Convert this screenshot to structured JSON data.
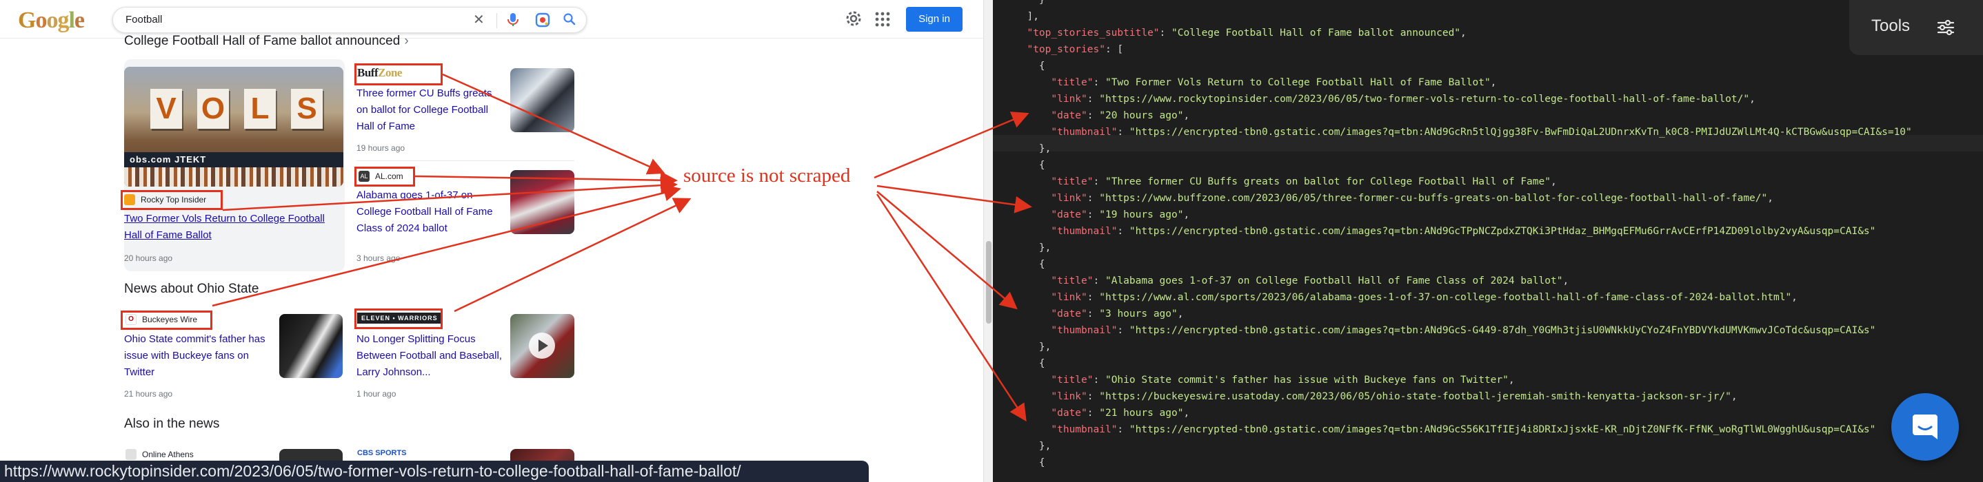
{
  "search": {
    "query": "Football",
    "signin_label": "Sign in"
  },
  "top_stories_left": {
    "section_title": "College Football Hall of Fame ballot announced",
    "featured": {
      "source": "Rocky Top Insider",
      "headline": "Two Former Vols Return to College Football Hall of Fame Ballot",
      "age": "20 hours ago",
      "hero_text": "VOLS"
    },
    "story_buffzone": {
      "source_logo_main": "Buff",
      "source_logo_accent": "Zone",
      "headline": "Three former CU Buffs greats on ballot for College Football Hall of Fame",
      "age": "19 hours ago"
    },
    "story_al": {
      "source": "AL.com",
      "headline": "Alabama goes 1-of-37 on College Football Hall of Fame Class of 2024 ballot",
      "age": "3 hours ago"
    }
  },
  "ohio_state": {
    "section_title": "News about Ohio State",
    "story_buckeyes": {
      "source": "Buckeyes Wire",
      "headline": "Ohio State commit's father has issue with Buckeye fans on Twitter",
      "age": "21 hours ago"
    },
    "story_elevenwarriors": {
      "source": "ELEVEN • WARRIORS",
      "headline": "No Longer Splitting Focus Between Football and Baseball, Larry Johnson...",
      "age": "1 hour ago"
    }
  },
  "also_in_news": {
    "section_title": "Also in the news",
    "source_1": "Online Athens",
    "source_2": "CBS SPORTS"
  },
  "hero_strip_text": "obs.com   JTEKT",
  "status_url": "https://www.rockytopinsider.com/2023/06/05/two-former-vols-return-to-college-football-hall-of-fame-ballot/",
  "annotation": "source is not scraped",
  "tools_label": "Tools",
  "code_lines": [
    [
      "p",
      "    }"
    ],
    [
      "p",
      "  ],"
    ],
    [
      "kv",
      "  ",
      "\"top_stories_subtitle\"",
      ": ",
      "\"College Football Hall of Fame ballot announced\"",
      ","
    ],
    [
      "kv",
      "  ",
      "\"top_stories\"",
      ": [",
      "",
      ""
    ],
    [
      "p",
      "    {"
    ],
    [
      "kv",
      "      ",
      "\"title\"",
      ": ",
      "\"Two Former Vols Return to College Football Hall of Fame Ballot\"",
      ","
    ],
    [
      "kv",
      "      ",
      "\"link\"",
      ": ",
      "\"https://www.rockytopinsider.com/2023/06/05/two-former-vols-return-to-college-football-hall-of-fame-ballot/\"",
      ","
    ],
    [
      "kv",
      "      ",
      "\"date\"",
      ": ",
      "\"20 hours ago\"",
      ","
    ],
    [
      "kv",
      "      ",
      "\"thumbnail\"",
      ": ",
      "\"https://encrypted-tbn0.gstatic.com/images?q=tbn:ANd9GcRn5tlQjgg38Fv-BwFmDiQaL2UDnrxKvTn_k0C8-PMIJdUZWlLMt4Q-kCTBGw&usqp=CAI&s=10\"",
      ""
    ],
    [
      "p",
      "    },"
    ],
    [
      "p",
      "    {"
    ],
    [
      "kv",
      "      ",
      "\"title\"",
      ": ",
      "\"Three former CU Buffs greats on ballot for College Football Hall of Fame\"",
      ","
    ],
    [
      "kv",
      "      ",
      "\"link\"",
      ": ",
      "\"https://www.buffzone.com/2023/06/05/three-former-cu-buffs-greats-on-ballot-for-college-football-hall-of-fame/\"",
      ","
    ],
    [
      "kv",
      "      ",
      "\"date\"",
      ": ",
      "\"19 hours ago\"",
      ","
    ],
    [
      "kv",
      "      ",
      "\"thumbnail\"",
      ": ",
      "\"https://encrypted-tbn0.gstatic.com/images?q=tbn:ANd9GcTPpNCZpdxZTQKi3PtHdaz_BHMgqEFMu6GrrAvCErfP14ZD09lolby2vyA&usqp=CAI&s\"",
      ""
    ],
    [
      "p",
      "    },"
    ],
    [
      "p",
      "    {"
    ],
    [
      "kv",
      "      ",
      "\"title\"",
      ": ",
      "\"Alabama goes 1-of-37 on College Football Hall of Fame Class of 2024 ballot\"",
      ","
    ],
    [
      "kv",
      "      ",
      "\"link\"",
      ": ",
      "\"https://www.al.com/sports/2023/06/alabama-goes-1-of-37-on-college-football-hall-of-fame-class-of-2024-ballot.html\"",
      ","
    ],
    [
      "kv",
      "      ",
      "\"date\"",
      ": ",
      "\"3 hours ago\"",
      ","
    ],
    [
      "kv",
      "      ",
      "\"thumbnail\"",
      ": ",
      "\"https://encrypted-tbn0.gstatic.com/images?q=tbn:ANd9GcS-G449-87dh_Y0GMh3tjisU0WNkkUyCYoZ4FnYBDVYkdUMVKmwvJCoTdc&usqp=CAI&s\"",
      ""
    ],
    [
      "p",
      "    },"
    ],
    [
      "p",
      "    {"
    ],
    [
      "kv",
      "      ",
      "\"title\"",
      ": ",
      "\"Ohio State commit's father has issue with Buckeye fans on Twitter\"",
      ","
    ],
    [
      "kv",
      "      ",
      "\"link\"",
      ": ",
      "\"https://buckeyeswire.usatoday.com/2023/06/05/ohio-state-football-jeremiah-smith-kenyatta-jackson-sr-jr/\"",
      ","
    ],
    [
      "kv",
      "      ",
      "\"date\"",
      ": ",
      "\"21 hours ago\"",
      ","
    ],
    [
      "kv",
      "      ",
      "\"thumbnail\"",
      ": ",
      "\"https://encrypted-tbn0.gstatic.com/images?q=tbn:ANd9GcS56K1TfIEj4i8DRIxJjsxkE-KR_nDjtZ0NFfK-FfNK_woRgTlWL0WgghU&usqp=CAI&s\"",
      ""
    ],
    [
      "p",
      "    },"
    ],
    [
      "p",
      "    {"
    ]
  ],
  "colors": {
    "accent_blue": "#1a73e8",
    "link": "#1a0dab",
    "annotation_red": "#e0321c",
    "code_key": "#f07178",
    "code_string": "#c3e88d",
    "code_bg": "#1e1e1e"
  },
  "icons": {
    "clear": "close-icon",
    "mic": "microphone-icon",
    "lens": "camera-lens-icon",
    "search": "search-icon",
    "settings": "gear-icon",
    "apps": "apps-grid-icon",
    "tools": "sliders-icon",
    "chat": "chat-bubble-icon"
  }
}
